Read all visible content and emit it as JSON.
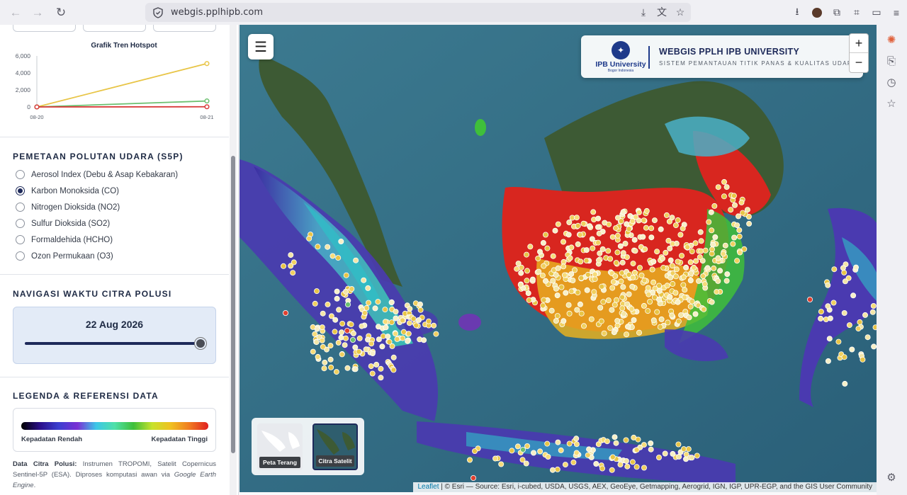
{
  "browser": {
    "url": "webgis.pplhipb.com"
  },
  "chart_data": {
    "type": "line",
    "title": "Grafik Tren Hotspot",
    "categories": [
      "08-20",
      "08-21"
    ],
    "ylim": [
      0,
      6000
    ],
    "yticks": [
      "0",
      "2,000",
      "4,000",
      "6,000"
    ],
    "series": [
      {
        "values": [
          0,
          5100
        ],
        "color": "#e8c547"
      },
      {
        "values": [
          0,
          700
        ],
        "color": "#6cc070"
      },
      {
        "values": [
          0,
          20
        ],
        "color": "#d93b3b"
      }
    ]
  },
  "pollutant": {
    "title": "PEMETAAN POLUTAN UDARA (S5P)",
    "options": [
      {
        "label": "Aerosol Index (Debu & Asap Kebakaran)",
        "checked": false
      },
      {
        "label": "Karbon Monoksida (CO)",
        "checked": true
      },
      {
        "label": "Nitrogen Dioksida (NO2)",
        "checked": false
      },
      {
        "label": "Sulfur Dioksida (SO2)",
        "checked": false
      },
      {
        "label": "Formaldehida (HCHO)",
        "checked": false
      },
      {
        "label": "Ozon Permukaan (O3)",
        "checked": false
      }
    ]
  },
  "time_nav": {
    "title": "NAVIGASI WAKTU CITRA POLUSI",
    "date": "22 Aug 2026",
    "slider_fraction": 1.0
  },
  "legend": {
    "title": "LEGENDA & REFERENSI DATA",
    "low": "Kepadatan Rendah",
    "high": "Kepadatan Tinggi",
    "source_label": "Data Citra Polusi:",
    "source_text": " Instrumen TROPOMI, Satelit Copernicus Sentinel-5P (ESA). Diproses komputasi awan via ",
    "source_engine": "Google Earth Engine",
    "source_end": "."
  },
  "map": {
    "header_title": "WEBGIS PPLH IPB UNIVERSITY",
    "header_subtitle": "SISTEM PEMANTAUAN TITIK PANAS & KUALITAS UDARA",
    "logo_name": "IPB University",
    "logo_tagline": "Bogor Indonesia",
    "zoom_in": "+",
    "zoom_out": "−",
    "base_light": "Peta Terang",
    "base_satellite": "Citra Satelit",
    "attribution_leaflet": "Leaflet",
    "attribution_text": " | © Esri — Source: Esri, i-cubed, USDA, USGS, AEX, GeoEye, Getmapping, Aerogrid, IGN, IGP, UPR-EGP, and the GIS User Community"
  }
}
